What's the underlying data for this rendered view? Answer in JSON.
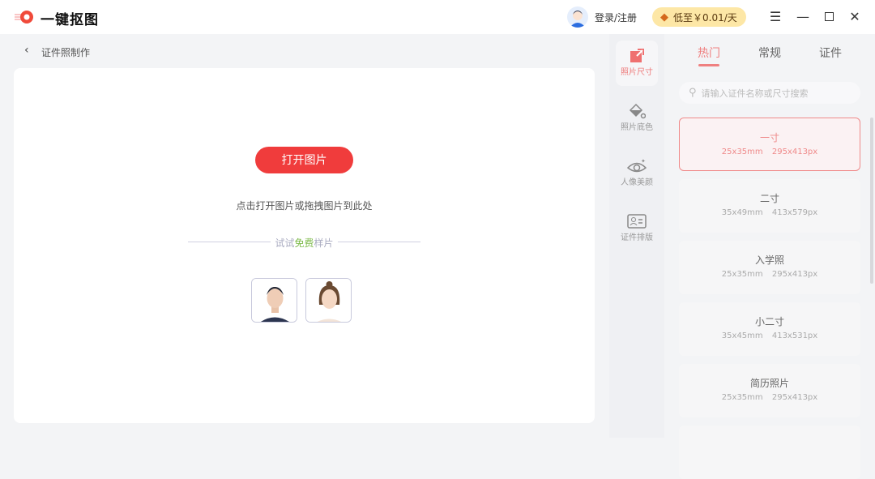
{
  "app": {
    "name": "一键抠图"
  },
  "header": {
    "login": "登录/注册",
    "vip": "低至￥0.01/天"
  },
  "breadcrumb": {
    "title": "证件照制作"
  },
  "main": {
    "open_button": "打开图片",
    "hint": "点击打开图片或拖拽图片到此处",
    "sample_pre": "试试",
    "sample_free": "免费",
    "sample_post": "样片"
  },
  "tools": [
    {
      "label": "照片尺寸"
    },
    {
      "label": "照片底色"
    },
    {
      "label": "人像美颜"
    },
    {
      "label": "证件排版"
    }
  ],
  "tabs": [
    {
      "label": "热门"
    },
    {
      "label": "常规"
    },
    {
      "label": "证件"
    }
  ],
  "search": {
    "placeholder": "请输入证件名称或尺寸搜索"
  },
  "sizes": [
    {
      "name": "一寸",
      "mm": "25x35mm",
      "px": "295x413px"
    },
    {
      "name": "二寸",
      "mm": "35x49mm",
      "px": "413x579px"
    },
    {
      "name": "入学照",
      "mm": "25x35mm",
      "px": "295x413px"
    },
    {
      "name": "小二寸",
      "mm": "35x45mm",
      "px": "413x531px"
    },
    {
      "name": "简历照片",
      "mm": "25x35mm",
      "px": "295x413px"
    }
  ],
  "colors": {
    "accent": "#f03c3c",
    "tab_active": "#ef8080",
    "vip_bg": "#fde7a6"
  }
}
